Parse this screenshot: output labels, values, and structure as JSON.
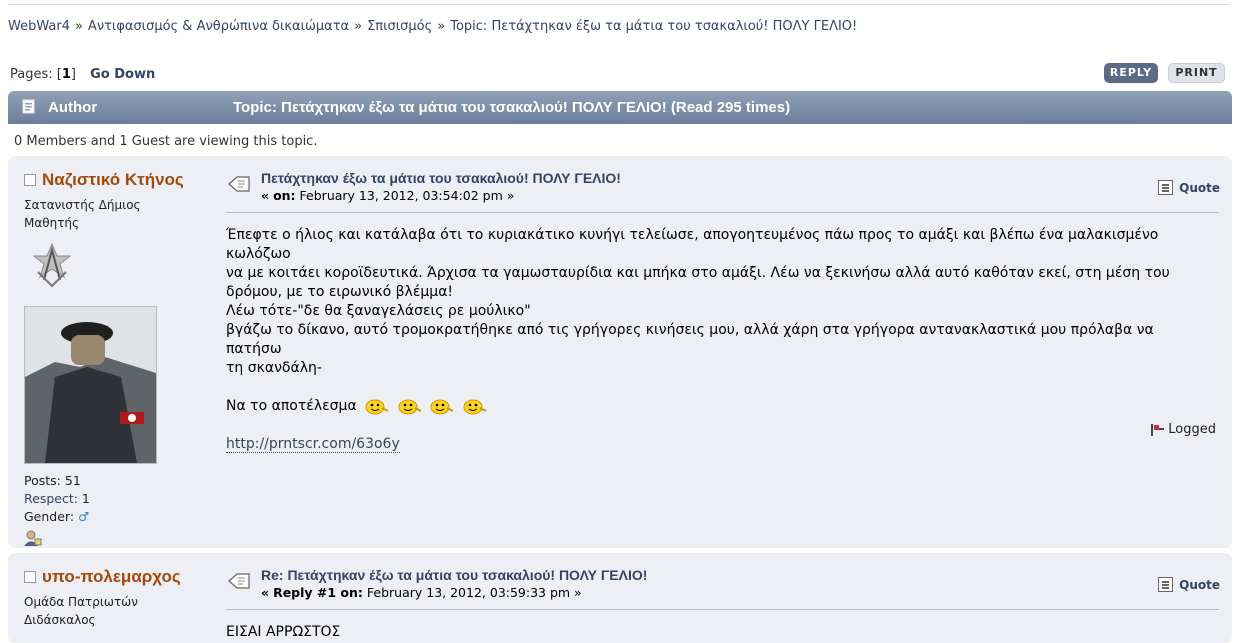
{
  "breadcrumb": {
    "items": [
      "WebWar4",
      "Αντιφασισμός & Ανθρώπινα δικαιώματα",
      "Σπισισμός"
    ],
    "current": "Topic: Πετάχτηκαν έξω τα μάτια του τσακαλιού! ΠΟΛΥ ΓΕΛΙΟ!",
    "separator": "»"
  },
  "pagination": {
    "label": "Pages: [",
    "current": "1",
    "close": "]",
    "go_down": "Go Down"
  },
  "buttons": {
    "reply": "REPLY",
    "print": "PRINT"
  },
  "header": {
    "author_col": "Author",
    "topic_title": "Topic: Πετάχτηκαν έξω τα μάτια του τσακαλιού! ΠΟΛΥ ΓΕΛΙΟ!  (Read 295 times)"
  },
  "viewing": "0 Members and 1 Guest are viewing this topic.",
  "posts": [
    {
      "poster_name": "Ναζιστικό Κτήνος",
      "poster_title": "Σατανιστής Δήμιος",
      "poster_rank": "Μαθητής",
      "posts_label": "Posts:",
      "posts_count": "51",
      "respect_label": "Respect:",
      "respect_value": "1",
      "gender_label": "Gender:",
      "gender_icon": "♂",
      "subject": "Πετάχτηκαν έξω τα μάτια του τσακαλιού! ΠΟΛΥ ΓΕΛΙΟ!",
      "meta_prefix": "«",
      "meta_on": "on:",
      "meta_date": "February 13, 2012, 03:54:02 pm »",
      "quote": "Quote",
      "body_lines": [
        "Έπεφτε ο ήλιος και κατάλαβα ότι το κυριακάτικο κυνήγι τελείωσε, απογοητευμένος πάω προς το αμάξι και βλέπω ένα μαλακισμένο κωλόζωο",
        "να με κοιτάει κοροϊδευτικά. Άρχισα τα γαμωσταυρίδια και μπήκα στο αμάξι. Λέω να ξεκινήσω αλλά αυτό καθόταν εκεί, στη μέση του",
        "δρόμου, με το ειρωνικό βλέμμα!",
        "Λέω τότε-\"δε θα ξαναγελάσεις ρε μούλικο\"",
        "βγάζω το δίκανο, αυτό τρομοκρατήθηκε από τις γρήγορες κινήσεις μου, αλλά χάρη στα γρήγορα αντανακλαστικά μου πρόλαβα να πατήσω",
        "τη σκανδάλη-"
      ],
      "result_text": "Να το αποτέλεσμα",
      "link": "http://prntscr.com/63o6y",
      "logged": "Logged"
    },
    {
      "poster_name": "υπο-πολεμαρχος",
      "poster_title": "Ομάδα Πατριωτών",
      "poster_rank": "Διδάσκαλος",
      "subject": "Re: Πετάχτηκαν έξω τα μάτια του τσακαλιού! ΠΟΛΥ ΓΕΛΙΟ!",
      "meta_prefix": "«",
      "meta_reply": "Reply #1 on:",
      "meta_date": "February 13, 2012, 03:59:33 pm »",
      "quote": "Quote",
      "body_start": "ΕΙΣΑΙ ΑΡΡΩΣΤΟΣ"
    }
  ],
  "colors": {
    "header_bar": "#7b8ca5",
    "poster_name": "#a3490a",
    "link": "#334466",
    "post_bg": "#edeff4"
  }
}
